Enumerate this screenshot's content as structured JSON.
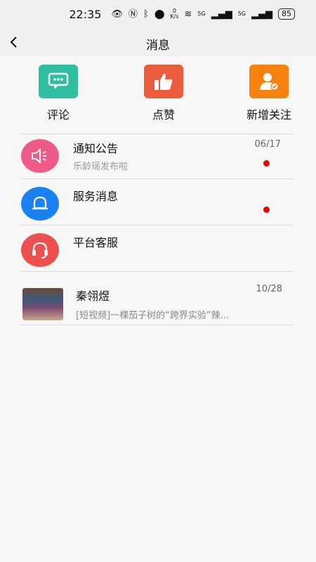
{
  "status_bar": {
    "time": "22:35",
    "net_speed_value": "0",
    "net_speed_unit": "K/s",
    "signal1": "5G",
    "signal2": "5G",
    "battery": "85"
  },
  "header": {
    "title": "消息"
  },
  "quick_actions": [
    {
      "label": "评论",
      "color": "#2fbfa0",
      "icon": "comment-icon"
    },
    {
      "label": "点赞",
      "color": "#ec5b3c",
      "icon": "thumbs-up-icon"
    },
    {
      "label": "新增关注",
      "color": "#f5820f",
      "icon": "follow-user-icon"
    }
  ],
  "messages": [
    {
      "name": "通知公告",
      "preview": "乐龄瑶发布啦",
      "date": "06/17",
      "unread": true,
      "color": "#ee5b86",
      "icon": "speaker-icon"
    },
    {
      "name": "服务消息",
      "preview": "",
      "date": "",
      "unread": true,
      "color": "#1a82f0",
      "icon": "bell-icon"
    },
    {
      "name": "平台客服",
      "preview": "",
      "date": "",
      "unread": false,
      "color": "#ee4f4f",
      "icon": "headset-icon"
    },
    {
      "name": "秦翎煜",
      "preview": "[短视频]一棵茄子树的“跨界实验”辣...",
      "date": "10/28",
      "unread": false,
      "icon": "user-thumbnail"
    }
  ]
}
